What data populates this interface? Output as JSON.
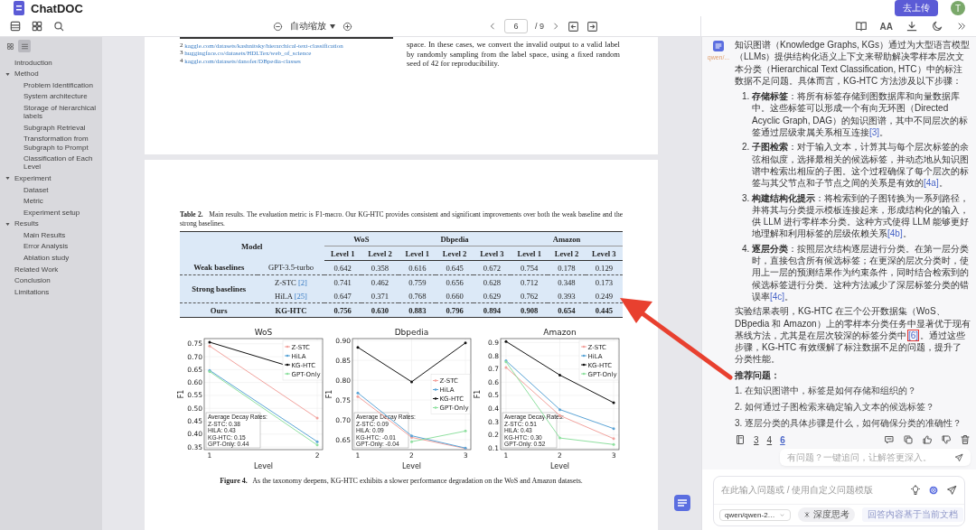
{
  "app": {
    "title": "ChatDOC",
    "upload_button": "去上传",
    "avatar": "T"
  },
  "viewer_toolbar": {
    "zoom": "自动缩放",
    "page": "6",
    "page_total": "/ 9"
  },
  "panel_toolbar": {
    "text_size": "AA"
  },
  "outline": {
    "tabs": [
      {
        "kind": "thumbnails",
        "selected": false
      },
      {
        "kind": "outline",
        "selected": true
      }
    ],
    "items": [
      {
        "label": "Introduction"
      },
      {
        "label": "Method",
        "expanded": true,
        "children": [
          {
            "label": "Problem Identification"
          },
          {
            "label": "System architecture"
          },
          {
            "label": "Storage of hierarchical labels"
          },
          {
            "label": "Subgraph Retrieval"
          },
          {
            "label": "Transformation from Subgraph to Prompt"
          },
          {
            "label": "Classification of Each Level"
          }
        ]
      },
      {
        "label": "Experiment",
        "expanded": true,
        "children": [
          {
            "label": "Dataset"
          },
          {
            "label": "Metric"
          },
          {
            "label": "Experiment setup"
          }
        ]
      },
      {
        "label": "Results",
        "expanded": true,
        "children": [
          {
            "label": "Main Results"
          },
          {
            "label": "Error Analysis"
          },
          {
            "label": "Ablation study"
          }
        ]
      },
      {
        "label": "Related Work"
      },
      {
        "label": "Conclusion"
      },
      {
        "label": "Limitations"
      }
    ]
  },
  "page_top": {
    "footnotes": [
      {
        "mark": "2",
        "link": "kaggle.com/datasets/kashnitsky/hierarchical-text-classification"
      },
      {
        "mark": "3",
        "link": "huggingface.co/datasets/HDLTex/web_of_science"
      },
      {
        "mark": "4",
        "link": "kaggle.com/datasets/danofer/DBpedia-classes"
      }
    ],
    "text": "space. In these cases, we convert the invalid output to a valid label by randomly sampling from the label space, using a fixed random seed of 42 for reproducibility."
  },
  "table": {
    "caption_label": "Table 2.",
    "caption": "Main results. The evaluation metric is F1-macro. Our KG-HTC provides consistent and significant improvements over both the weak baseline and the strong baselines.",
    "model_header": "Model",
    "groups": [
      {
        "name": "WoS",
        "levels": [
          "Level 1",
          "Level 2"
        ]
      },
      {
        "name": "Dbpedia",
        "levels": [
          "Level 1",
          "Level 2",
          "Level 3"
        ]
      },
      {
        "name": "Amazon",
        "levels": [
          "Level 1",
          "Level 2",
          "Level 3"
        ]
      }
    ],
    "sections": [
      {
        "group": "Weak baselines",
        "highlight": false,
        "rows": [
          {
            "model": "GPT-3.5-turbo",
            "values": [
              "0.642",
              "0.358",
              "0.616",
              "0.645",
              "0.672",
              "0.754",
              "0.178",
              "0.129"
            ]
          }
        ]
      },
      {
        "group": "Strong baselines",
        "highlight": false,
        "rows": [
          {
            "model": "Z-STC",
            "cite": "[2]",
            "values": [
              "0.741",
              "0.462",
              "0.759",
              "0.656",
              "0.628",
              "0.712",
              "0.348",
              "0.173"
            ]
          },
          {
            "model": "HiLA",
            "cite": "[25]",
            "values": [
              "0.647",
              "0.371",
              "0.768",
              "0.660",
              "0.629",
              "0.762",
              "0.393",
              "0.249"
            ]
          }
        ]
      },
      {
        "group": "Ours",
        "highlight": true,
        "rows": [
          {
            "model": "KG-HTC",
            "values": [
              "0.756",
              "0.630",
              "0.883",
              "0.796",
              "0.894",
              "0.908",
              "0.654",
              "0.445"
            ]
          }
        ]
      }
    ]
  },
  "figure": {
    "caption_label": "Figure 4.",
    "caption": "As the taxonomy deepens, KG-HTC exhibits a slower performance degradation on the WoS and Amazon datasets.",
    "charts": [
      {
        "chart_data": {
          "type": "line",
          "title": "WoS",
          "xlabel": "Level",
          "ylabel": "F1",
          "x": [
            1,
            2
          ],
          "xticks": [
            1,
            2
          ],
          "xlim": [
            0.95,
            2.05
          ],
          "ylim": [
            0.34,
            0.77
          ],
          "grid": true,
          "legend": "upper right",
          "yticks": [
            {
              "value": 0.35,
              "label": "0.35"
            },
            {
              "value": 0.4,
              "label": "0.40"
            },
            {
              "value": 0.45,
              "label": "0.45"
            },
            {
              "value": 0.5,
              "label": "0.50"
            },
            {
              "value": 0.55,
              "label": "0.55"
            },
            {
              "value": 0.6,
              "label": "0.60"
            },
            {
              "value": 0.65,
              "label": "0.65"
            },
            {
              "value": 0.7,
              "label": "0.70"
            },
            {
              "value": 0.75,
              "label": "0.75"
            }
          ],
          "series": [
            {
              "name": "Z-STC",
              "color": "#f2a29d",
              "values": [
                0.741,
                0.462
              ]
            },
            {
              "name": "HiLA",
              "color": "#5ba4d6",
              "values": [
                0.647,
                0.371
              ]
            },
            {
              "name": "KG-HTC",
              "color": "#111111",
              "values": [
                0.756,
                0.63
              ]
            },
            {
              "name": "GPT-Only",
              "color": "#8fe0a0",
              "values": [
                0.642,
                0.358
              ]
            }
          ],
          "annotations": [
            "Average Decay Rates:",
            "Z-STC: 0.38",
            "HiLA: 0.43",
            "KG-HTC: 0.15",
            "GPT-Only: 0.44"
          ]
        }
      },
      {
        "chart_data": {
          "type": "line",
          "title": "Dbpedia",
          "xlabel": "Level",
          "ylabel": "F1",
          "x": [
            1,
            2,
            3
          ],
          "xticks": [
            1,
            2,
            3
          ],
          "xlim": [
            0.9,
            3.1
          ],
          "ylim": [
            0.625,
            0.905
          ],
          "grid": true,
          "legend": "center right",
          "yticks": [
            {
              "value": 0.65,
              "label": "0.65"
            },
            {
              "value": 0.7,
              "label": "0.70"
            },
            {
              "value": 0.75,
              "label": "0.75"
            },
            {
              "value": 0.8,
              "label": "0.80"
            },
            {
              "value": 0.85,
              "label": "0.85"
            },
            {
              "value": 0.9,
              "label": "0.90"
            }
          ],
          "series": [
            {
              "name": "Z-STC",
              "color": "#f2a29d",
              "values": [
                0.759,
                0.656,
                0.628
              ]
            },
            {
              "name": "HiLA",
              "color": "#5ba4d6",
              "values": [
                0.768,
                0.66,
                0.629
              ]
            },
            {
              "name": "KG-HTC",
              "color": "#111111",
              "values": [
                0.883,
                0.796,
                0.894
              ]
            },
            {
              "name": "GPT-Only",
              "color": "#8fe0a0",
              "values": [
                null,
                0.645,
                0.672
              ]
            }
          ],
          "annotations": [
            "Average Decay Rates:",
            "Z-STC: 0.09",
            "HiLA: 0.09",
            "KG-HTC: -0.01",
            "GPT-Only: -0.04"
          ]
        }
      },
      {
        "chart_data": {
          "type": "line",
          "title": "Amazon",
          "xlabel": "Level",
          "ylabel": "F1",
          "x": [
            1,
            2,
            3
          ],
          "xticks": [
            1,
            2,
            3
          ],
          "xlim": [
            0.9,
            3.1
          ],
          "ylim": [
            0.09,
            0.93
          ],
          "grid": true,
          "legend": "upper right",
          "yticks": [
            {
              "value": 0.1,
              "label": "0.1"
            },
            {
              "value": 0.2,
              "label": "0.2"
            },
            {
              "value": 0.3,
              "label": "0.3"
            },
            {
              "value": 0.4,
              "label": "0.4"
            },
            {
              "value": 0.5,
              "label": "0.5"
            },
            {
              "value": 0.6,
              "label": "0.6"
            },
            {
              "value": 0.7,
              "label": "0.7"
            },
            {
              "value": 0.8,
              "label": "0.8"
            },
            {
              "value": 0.9,
              "label": "0.9"
            }
          ],
          "series": [
            {
              "name": "Z-STC",
              "color": "#f2a29d",
              "values": [
                0.712,
                0.348,
                0.173
              ]
            },
            {
              "name": "HiLA",
              "color": "#5ba4d6",
              "values": [
                0.762,
                0.393,
                0.249
              ]
            },
            {
              "name": "KG-HTC",
              "color": "#111111",
              "values": [
                0.908,
                0.654,
                0.445
              ]
            },
            {
              "name": "GPT-Only",
              "color": "#8fe0a0",
              "values": [
                0.754,
                0.178,
                0.129
              ]
            }
          ],
          "annotations": [
            "Average Decay Rates:",
            "Z-STC: 0.51",
            "HiLA: 0.43",
            "KG-HTC: 0.30",
            "GPT-Only: 0.52"
          ]
        }
      }
    ]
  },
  "assistant": {
    "model_tag": "qwen/...",
    "intro": "知识图谱（Knowledge Graphs, KGs）通过为大型语言模型（LLMs）提供结构化语义上下文来帮助解决零样本层次文本分类（Hierarchical Text Classification, HTC）中的标注数据不足问题。具体而言，KG-HTC 方法涉及以下步骤：",
    "steps": [
      {
        "number": "1.",
        "title": "存储标签",
        "text": "：将所有标签存储到图数据库和向量数据库中。这些标签可以形成一个有向无环图（Directed Acyclic Graph, DAG）的知识图谱，其中不同层次的标签通过层级隶属关系相互连接",
        "cite": "[3]",
        "end": "。"
      },
      {
        "number": "2.",
        "title": "子图检索",
        "text": "：对于输入文本，计算其与每个层次标签的余弦相似度，选择最相关的候选标签，并动态地从知识图谱中检索出相应的子图。这个过程确保了每个层次的标签与其父节点和子节点之间的关系是有效的",
        "cite": "[4a]",
        "end": "。"
      },
      {
        "number": "3.",
        "title": "构建结构化提示",
        "text": "：将检索到的子图转换为一系列路径，并将其与分类提示模板连接起来，形成结构化的输入，供 LLM 进行零样本分类。这种方式使得 LLM 能够更好地理解和利用标签的层级依赖关系",
        "cite": "[4b]",
        "end": "。"
      },
      {
        "number": "4.",
        "title": "逐层分类",
        "text": "：按照层次结构逐层进行分类。在第一层分类时，直接包含所有候选标签；在更深的层次分类时，使用上一层的预测结果作为约束条件，同时结合检索到的候选标签进行分类。这种方法减少了深层标签分类的错误率",
        "cite": "[4c]",
        "end": "。"
      }
    ],
    "conclusion": {
      "before": "实验结果表明，KG-HTC 在三个公开数据集（WoS、DBpedia 和 Amazon）上的零样本分类任务中显著优于现有基线方法，尤其是在层次较深的标签分类中",
      "cite": "[6]",
      "cite_boxed": true,
      "after": "。通过这些步骤，KG-HTC 有效缓解了标注数据不足的问题，提升了分类性能。"
    },
    "recommend_title": "推荐问题：",
    "questions": [
      "1. 在知识图谱中，标签是如何存储和组织的？",
      "2. 如何通过子图检索来确定输入文本的候选标签？",
      "3. 逐层分类的具体步骤是什么，如何确保分类的准确性？"
    ],
    "sources": [
      {
        "label": "3",
        "selected": false
      },
      {
        "label": "4",
        "selected": false
      },
      {
        "label": "6",
        "selected": true
      }
    ],
    "follow_up_placeholder": "有问题？一键追问，让解答更深入。"
  },
  "composer": {
    "placeholder": "在此输入问题或 / 使用自定义问题模版",
    "model": "qwen/qwen-2…",
    "deep_think": {
      "label": "深度思考",
      "on": false
    },
    "note": "回答内容基于当前文档"
  }
}
